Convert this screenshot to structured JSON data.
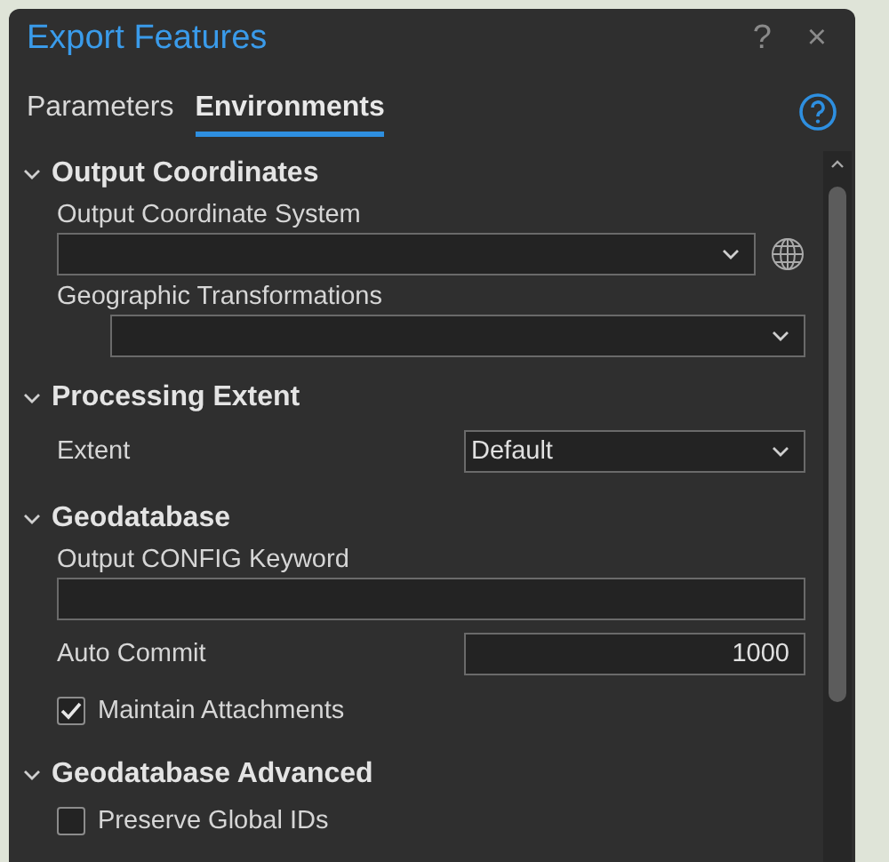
{
  "window": {
    "title": "Export Features",
    "help": "?",
    "close": "×"
  },
  "tabs": [
    {
      "label": "Parameters",
      "selected": false
    },
    {
      "label": "Environments",
      "selected": true
    }
  ],
  "sections": [
    {
      "title": "Output Coordinates",
      "expanded": true,
      "items": [
        {
          "kind": "combo",
          "label": "Output Coordinate System",
          "value": "",
          "globe": true
        },
        {
          "kind": "combo-indented",
          "label": "Geographic Transformations",
          "value": ""
        }
      ]
    },
    {
      "title": "Processing Extent",
      "expanded": true,
      "items": [
        {
          "kind": "combo-inline",
          "label": "Extent",
          "value": "Default"
        }
      ]
    },
    {
      "title": "Geodatabase",
      "expanded": true,
      "items": [
        {
          "kind": "text",
          "label": "Output CONFIG Keyword",
          "value": ""
        },
        {
          "kind": "number-inline",
          "label": "Auto Commit",
          "value": "1000"
        },
        {
          "kind": "checkbox",
          "label": "Maintain Attachments",
          "checked": true
        }
      ]
    },
    {
      "title": "Geodatabase Advanced",
      "expanded": true,
      "items": [
        {
          "kind": "checkbox",
          "label": "Preserve Global IDs",
          "checked": false
        }
      ]
    }
  ]
}
